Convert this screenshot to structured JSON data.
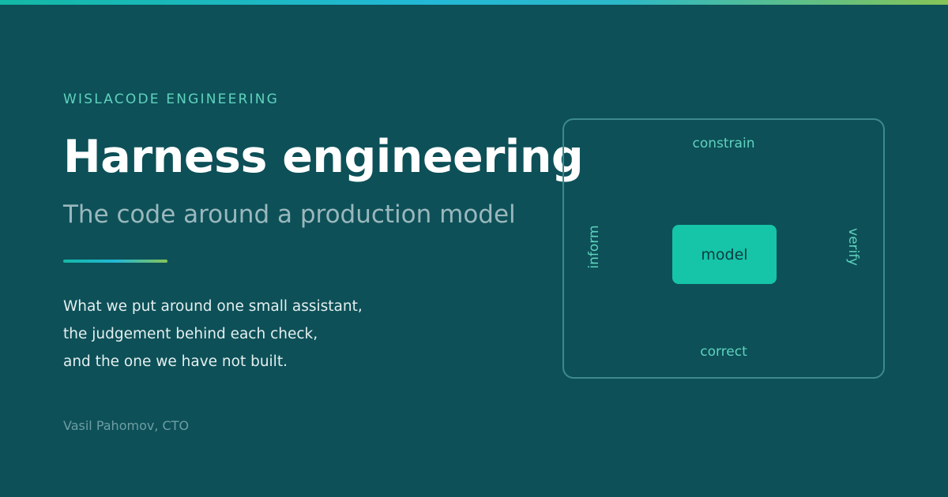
{
  "brand": {
    "eyebrow": "WISLACODE ENGINEERING"
  },
  "hero": {
    "title": "Harness engineering",
    "subtitle": "The code around a production model"
  },
  "body": {
    "lines": [
      "What we put around one small assistant,",
      "the judgement behind each check,",
      "and the one we have not built."
    ]
  },
  "author": {
    "byline": "Vasil Pahomov, CTO"
  },
  "diagram": {
    "top_label": "constrain",
    "left_label": "inform",
    "right_label": "verify",
    "bottom_label": "correct",
    "center_label": "model"
  },
  "colors": {
    "background": "#0d5058",
    "accent": "#5fd3bd",
    "model_fill": "#16c4a8",
    "frame_border": "#3d8a8d"
  }
}
